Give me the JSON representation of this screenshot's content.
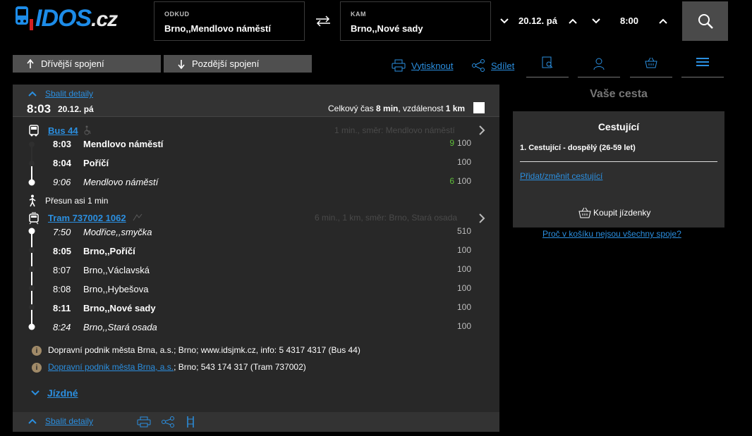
{
  "header": {
    "logo_text": "IDOS",
    "logo_suffix": ".cz",
    "from_label": "ODKUD",
    "from_value": "Brno,,Mendlovo náměstí",
    "to_label": "KAM",
    "to_value": "Brno,,Nové sady",
    "date": "20.12. pá",
    "time": "8:00"
  },
  "toolbar": {
    "earlier": "Dřívější spojení",
    "later": "Pozdější spojení",
    "print": "Vytisknout",
    "share": "Sdílet"
  },
  "connection": {
    "collapse_label": "Sbalit detaily",
    "dep_time": "8:03",
    "dep_date": "20.12. pá",
    "total_prefix": "Celkový čas ",
    "total_time": "8 min",
    "total_mid": ", vzdálenost ",
    "total_dist": "1 km",
    "legs": [
      {
        "line": "Bus 44",
        "meta": "1 min., směr: Mendlovo náměstí",
        "stops": [
          {
            "time": "8:03",
            "name": "Mendlovo náměstí",
            "platform": "9",
            "num": "100",
            "style": "bold"
          },
          {
            "time": "8:04",
            "name": "Poříčí",
            "platform": "",
            "num": "100",
            "style": "bold"
          },
          {
            "time": "9:06",
            "name": "Mendlovo náměstí",
            "platform": "6",
            "num": "100",
            "style": "italic"
          }
        ]
      },
      {
        "line": "Tram 737002 1062",
        "meta": "6 min., 1 km, směr: Brno, Stará osada",
        "stops": [
          {
            "time": "7:50",
            "name": "Modřice,,smyčka",
            "num": "510",
            "style": "italic"
          },
          {
            "time": "8:05",
            "name": "Brno,,Poříčí",
            "num": "100",
            "style": "bold"
          },
          {
            "time": "8:07",
            "name": "Brno,,Václavská",
            "num": "100",
            "style": "normal"
          },
          {
            "time": "8:08",
            "name": "Brno,,Hybešova",
            "num": "100",
            "style": "normal"
          },
          {
            "time": "8:11",
            "name": "Brno,,Nové sady",
            "num": "100",
            "style": "bold"
          },
          {
            "time": "8:24",
            "name": "Brno,,Stará osada",
            "num": "100",
            "style": "italic"
          }
        ]
      }
    ],
    "transfer": "Přesun asi 1 min",
    "info1": "Dopravní podnik města Brna, a.s.; Brno; www.idsjmk.cz, info: 5 4317 4317 (Bus 44)",
    "info2_link": "Dopravní podnik města Brna, a.s.",
    "info2_rest": "; Brno; 543 174 317 (Tram 737002)",
    "tickets_label": "Jízdné",
    "collapse_bottom": "Sbalit detaily"
  },
  "right": {
    "title": "Vaše cesta",
    "box_title": "Cestující",
    "passenger": "1. Cestující - dospělý (26-59 let)",
    "change_link": "Přidat/změnit cestující",
    "buy": "Koupit jízdenky",
    "why": "Proč v košíku nejsou všechny spoje?"
  },
  "colors": {
    "accent": "#2b8fe0",
    "green": "#5fbf3a",
    "panel": "#282828"
  }
}
